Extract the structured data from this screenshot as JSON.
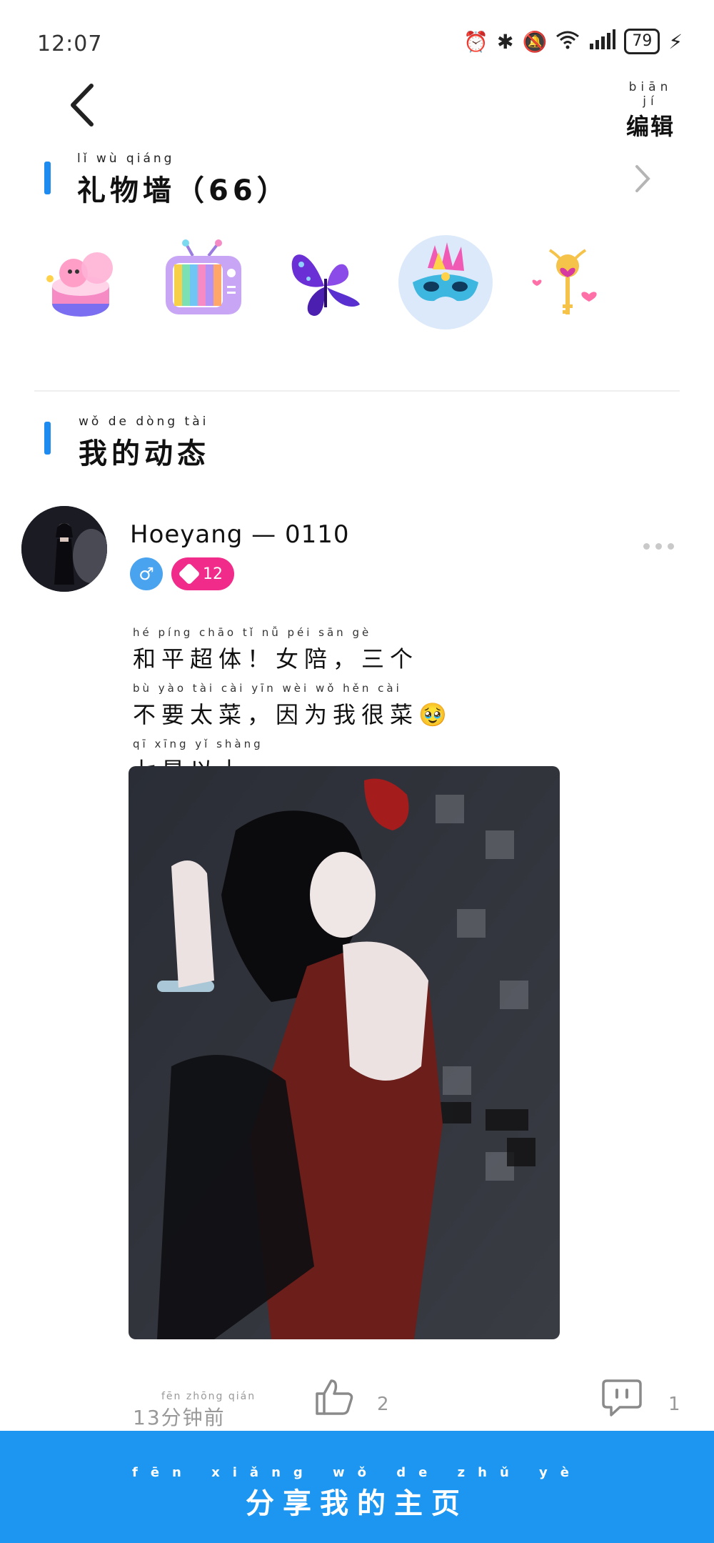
{
  "status_bar": {
    "time": "12:07",
    "battery": "79"
  },
  "nav": {
    "edit_pinyin": "biān jí",
    "edit_label": "编辑"
  },
  "gift_wall": {
    "pinyin": "lǐ wù qiáng",
    "title": "礼物墙（66）",
    "gifts": [
      "cake-gift-icon",
      "tv-gift-icon",
      "butterfly-gift-icon",
      "mask-gift-icon",
      "magic-wand-gift-icon"
    ]
  },
  "moments": {
    "pinyin": "wǒ de dòng tài",
    "title": "我的动态"
  },
  "post": {
    "username": "Hoeyang — 0110",
    "gender_icon": "♂",
    "level": "12",
    "lines": [
      {
        "pinyin": "hé píng chāo tǐ   nǚ péi   sān gè",
        "text": "和平超体！女陪，三个"
      },
      {
        "pinyin": "bù yào tài cài   yīn wèi wǒ hěn cài",
        "text": "不要太菜，因为我很菜🥹"
      },
      {
        "pinyin": "qī xīng yǐ shàng",
        "text": "七星以上"
      }
    ],
    "time_pinyin": "fēn zhōng qián",
    "time": "13分钟前",
    "likes": "2",
    "comments": "1"
  },
  "share": {
    "pinyin": "fēn xiǎng wǒ de zhǔ yè",
    "label": "分享我的主页"
  },
  "colors": {
    "accent": "#1c96f0",
    "badge_pink": "#f02b8a",
    "badge_blue": "#4aa3ef"
  }
}
